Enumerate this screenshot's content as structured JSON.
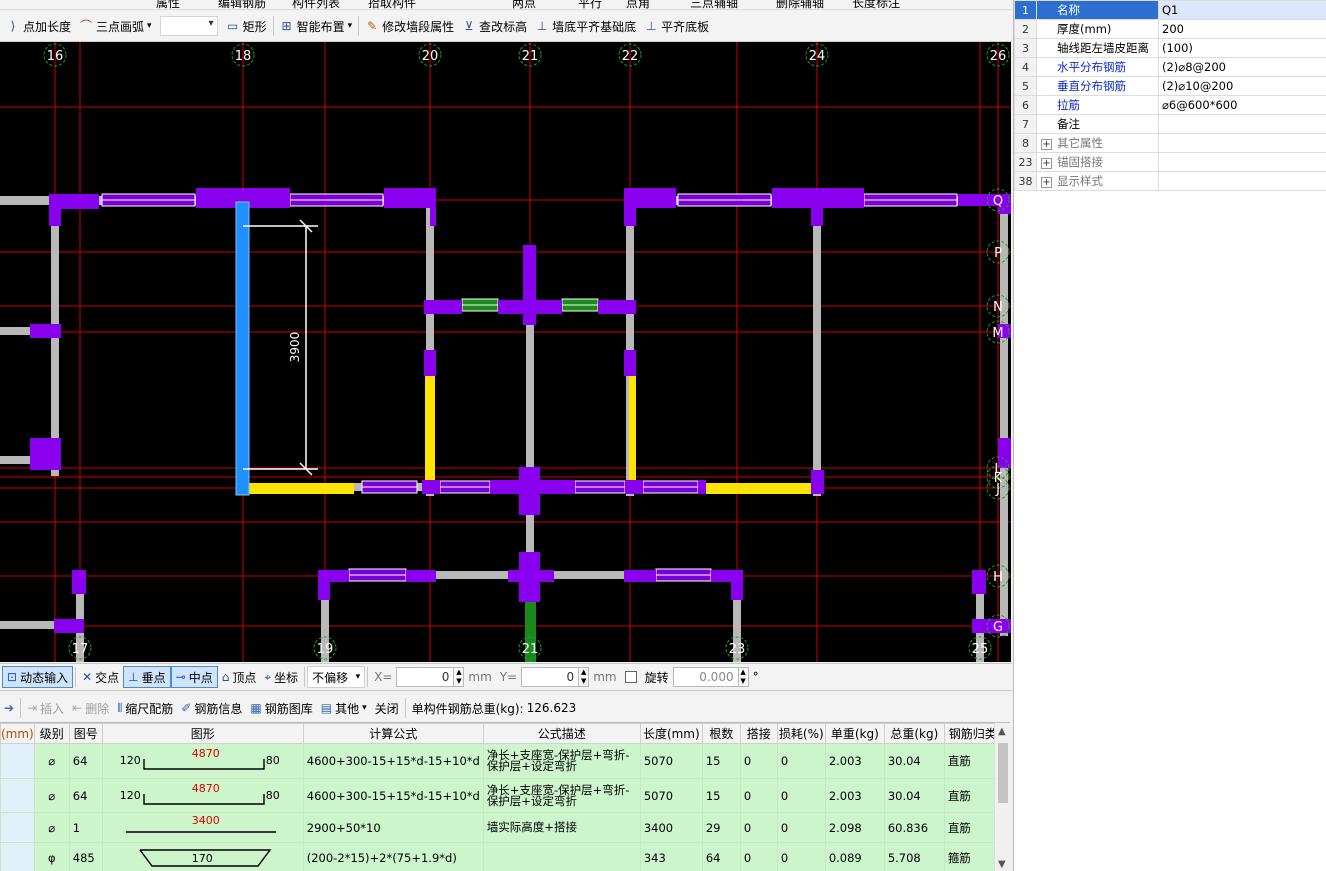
{
  "top_strip": {
    "fragments": [
      "属性",
      "编辑钢筋",
      "构件列表",
      "拾取构件",
      "两点",
      "平行",
      "点角",
      "三点辅轴",
      "删除辅轴",
      "长度标注"
    ]
  },
  "toolbar": {
    "items": [
      {
        "label": "点加长度",
        "icon": "add-length-icon"
      },
      {
        "label": "三点画弧",
        "icon": "arc-icon"
      },
      {
        "label": "矩形",
        "icon": "rectangle-icon"
      },
      {
        "label": "智能布置",
        "icon": "smart-layout-icon"
      },
      {
        "label": "修改墙段属性",
        "icon": "edit-wall-icon"
      },
      {
        "label": "查改标高",
        "icon": "elevation-icon"
      },
      {
        "label": "墙底平齐基础底",
        "icon": "align-foundation-icon"
      },
      {
        "label": "平齐底板",
        "icon": "align-slab-icon"
      }
    ]
  },
  "canvas": {
    "axis_labels_top": [
      "16",
      "18",
      "20",
      "21",
      "22",
      "24",
      "26"
    ],
    "axis_labels_bottom": [
      "17",
      "19",
      "21",
      "23",
      "25"
    ],
    "axis_labels_right": [
      "Q",
      "P",
      "N",
      "M",
      "L",
      "K",
      "J",
      "H",
      "G"
    ],
    "dimension_text": "3900",
    "colors": {
      "background": "#000000",
      "grid": "#d00000",
      "wall": "#b8b8b8",
      "column": "#8800ee",
      "selected_wall": "#1e90ff",
      "yellow_wall": "#ffe400",
      "green_wall": "#1a8a1a",
      "axis_circle": "#1fa01f"
    }
  },
  "properties": {
    "rows": [
      {
        "num": "1",
        "name": "名称",
        "value": "Q1",
        "style": "selected"
      },
      {
        "num": "2",
        "name": "厚度(mm)",
        "value": "200",
        "style": "normal"
      },
      {
        "num": "3",
        "name": "轴线距左墙皮距离",
        "value": "(100)",
        "style": "normal"
      },
      {
        "num": "4",
        "name": "水平分布钢筋",
        "value": "(2)⌀8@200",
        "style": "blue"
      },
      {
        "num": "5",
        "name": "垂直分布钢筋",
        "value": "(2)⌀10@200",
        "style": "blue"
      },
      {
        "num": "6",
        "name": "拉筋",
        "value": "⌀6@600*600",
        "style": "blue"
      },
      {
        "num": "7",
        "name": "备注",
        "value": "",
        "style": "normal"
      },
      {
        "num": "8",
        "name": "其它属性",
        "value": "",
        "style": "group"
      },
      {
        "num": "23",
        "name": "锚固搭接",
        "value": "",
        "style": "group"
      },
      {
        "num": "38",
        "name": "显示样式",
        "value": "",
        "style": "group"
      }
    ]
  },
  "statusbar": {
    "dynamic_input": "动态输入",
    "intersection": "交点",
    "perpendicular": "垂点",
    "midpoint": "中点",
    "vertex": "顶点",
    "coordinate": "坐标",
    "offset_mode": "不偏移",
    "x_label": "X=",
    "x_value": "0",
    "y_label": "Y=",
    "y_value": "0",
    "unit": "mm",
    "rotate_label": "旋转",
    "rotate_value": "0.000",
    "degree": "°"
  },
  "rebar_toolbar": {
    "insert": "插入",
    "delete": "删除",
    "scale_rebar": "缩尺配筋",
    "rebar_info": "钢筋信息",
    "rebar_library": "钢筋图库",
    "other": "其他",
    "close": "关闭",
    "total_weight_label": "单构件钢筋总重(kg):",
    "total_weight_value": "126.623"
  },
  "rebar_table": {
    "columns": [
      "(mm)",
      "级别",
      "图号",
      "图形",
      "计算公式",
      "公式描述",
      "长度(mm)",
      "根数",
      "搭接",
      "损耗(%)",
      "单重(kg)",
      "总重(kg)",
      "钢筋归类"
    ],
    "rows": [
      {
        "grade": "⌀",
        "fig": "64",
        "shape_left": "120",
        "shape_mid": "4870",
        "shape_right": "80",
        "formula": "4600+300-15+15*d-15+10*d",
        "desc": "净长+支座宽-保护层+弯折-保护层+设定弯折",
        "length": "5070",
        "count": "15",
        "lap": "0",
        "loss": "0",
        "unit_wt": "2.003",
        "total_wt": "30.04",
        "category": "直筋"
      },
      {
        "grade": "⌀",
        "fig": "64",
        "shape_left": "120",
        "shape_mid": "4870",
        "shape_right": "80",
        "formula": "4600+300-15+15*d-15+10*d",
        "desc": "净长+支座宽-保护层+弯折-保护层+设定弯折",
        "length": "5070",
        "count": "15",
        "lap": "0",
        "loss": "0",
        "unit_wt": "2.003",
        "total_wt": "30.04",
        "category": "直筋"
      },
      {
        "grade": "⌀",
        "fig": "1",
        "shape_left": "",
        "shape_mid": "3400",
        "shape_right": "",
        "formula": "2900+50*10",
        "desc": "墙实际高度+搭接",
        "length": "3400",
        "count": "29",
        "lap": "0",
        "loss": "0",
        "unit_wt": "2.098",
        "total_wt": "60.836",
        "category": "直筋"
      },
      {
        "grade": "φ",
        "fig": "485",
        "shape_left": "",
        "shape_mid": "170",
        "shape_right": "",
        "formula": "(200-2*15)+2*(75+1.9*d)",
        "desc": "",
        "length": "343",
        "count": "64",
        "lap": "0",
        "loss": "0",
        "unit_wt": "0.089",
        "total_wt": "5.708",
        "category": "箍筋"
      }
    ]
  }
}
